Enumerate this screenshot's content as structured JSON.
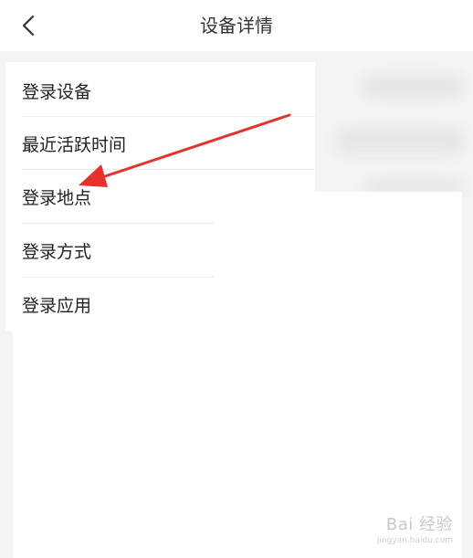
{
  "header": {
    "title": "设备详情",
    "back_icon": "chevron-left-icon"
  },
  "details": {
    "items": [
      {
        "label": "登录设备"
      },
      {
        "label": "最近活跃时间"
      },
      {
        "label": "登录地点"
      },
      {
        "label": "登录方式"
      },
      {
        "label": "登录应用"
      }
    ]
  },
  "annotation": {
    "arrow_color": "#e8302c",
    "points_to": "登录地点"
  },
  "watermark": {
    "brand": "Bai  经验",
    "site": "jingyan.baidu.com"
  },
  "colors": {
    "background_gray": "#f4f4f4",
    "card_white": "#ffffff",
    "text_primary": "#222222",
    "title_text": "#333333"
  }
}
